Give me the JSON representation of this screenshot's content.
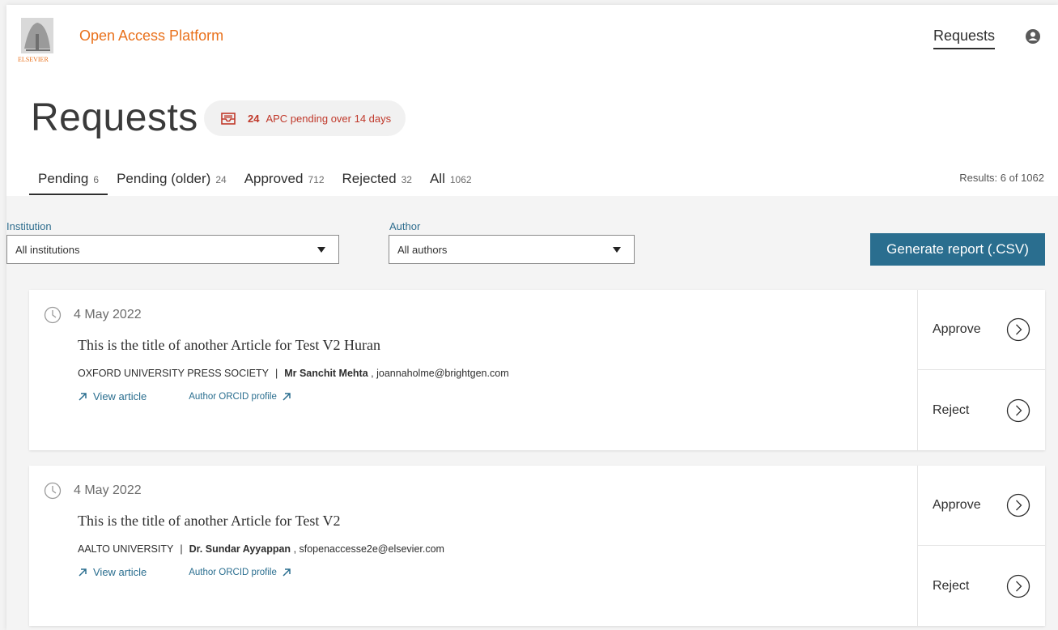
{
  "header": {
    "brand_text": "Open Access Platform",
    "logo_text": "ELSEVIER",
    "nav_requests": "Requests"
  },
  "page": {
    "title": "Requests",
    "badge": {
      "count": "24",
      "text": "APC pending over 14 days"
    }
  },
  "tabs": [
    {
      "label": "Pending",
      "count": "6",
      "active": true
    },
    {
      "label": "Pending (older)",
      "count": "24"
    },
    {
      "label": "Approved",
      "count": "712"
    },
    {
      "label": "Rejected",
      "count": "32"
    },
    {
      "label": "All",
      "count": "1062"
    }
  ],
  "results_text": "Results: 6 of 1062",
  "filters": {
    "institution": {
      "label": "Institution",
      "value": "All institutions"
    },
    "author": {
      "label": "Author",
      "value": "All authors"
    },
    "generate_label": "Generate report (.CSV)"
  },
  "requests": [
    {
      "date": "4 May 2022",
      "title": "This is the title of another Article for Test V2 Huran",
      "institution": "OXFORD UNIVERSITY PRESS SOCIETY",
      "author": "Mr Sanchit Mehta",
      "email": ", joannaholme@brightgen.com",
      "view_label": "View article",
      "orcid_label": "Author ORCID profile",
      "approve_label": "Approve",
      "reject_label": "Reject"
    },
    {
      "date": "4 May 2022",
      "title": "This is the title of another Article for Test V2",
      "institution": "AALTO UNIVERSITY",
      "author": "Dr. Sundar Ayyappan",
      "email": ", sfopenaccesse2e@elsevier.com",
      "view_label": "View article",
      "orcid_label": "Author ORCID profile",
      "approve_label": "Approve",
      "reject_label": "Reject"
    }
  ],
  "colors": {
    "brand_orange": "#e9711c",
    "accent_blue": "#2a6e8f",
    "alert_red": "#c0392b"
  },
  "icons": {
    "logo": "elsevier-tree-logo",
    "user": "user-avatar-icon",
    "badge": "inbox-tray-icon",
    "date": "clock-icon",
    "link": "arrow-up-right-icon",
    "action": "chevron-right-circle-icon",
    "select": "caret-down-icon"
  }
}
